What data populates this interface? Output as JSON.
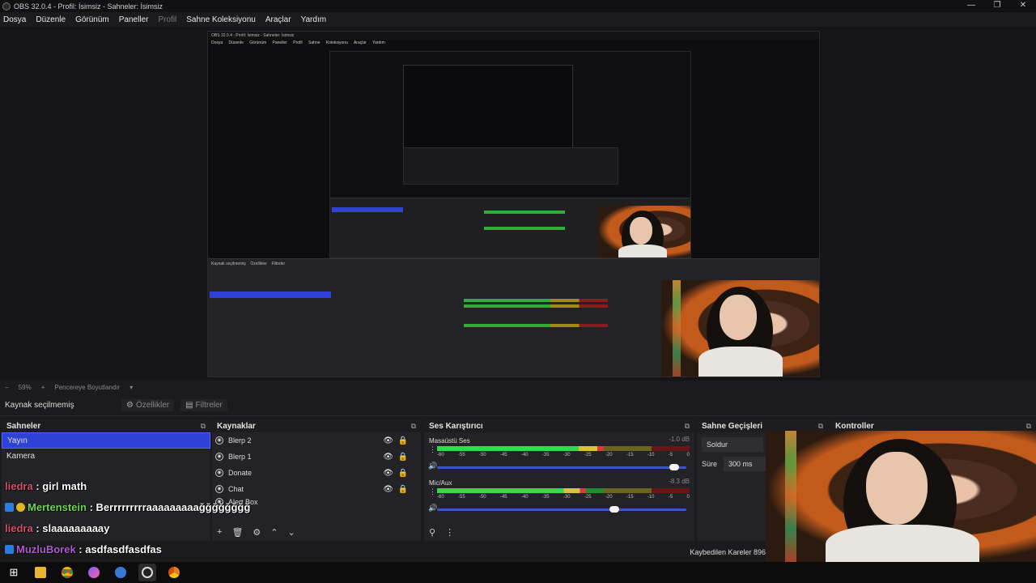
{
  "window": {
    "title": "OBS 32.0.4 - Profil: İsimsiz - Sahneler: İsimsiz"
  },
  "window_controls": {
    "min": "—",
    "max": "❐",
    "close": "✕"
  },
  "menu": [
    "Dosya",
    "Düzenle",
    "Görünüm",
    "Paneller",
    "Profil",
    "Sahne Koleksiyonu",
    "Araçlar",
    "Yardım"
  ],
  "menu_disabled": "Profil",
  "zoom": {
    "value": "59%",
    "plus": "+",
    "minus": "−",
    "mode": "Pencereye Boyutlandır"
  },
  "source_toolbar": {
    "no_selection": "Kaynak seçilmemiş",
    "properties": "Özellikler",
    "filters": "Filtreler"
  },
  "scenes": {
    "title": "Sahneler",
    "items": [
      "Yayın",
      "Kamera"
    ],
    "selected_index": 0
  },
  "sources": {
    "title": "Kaynaklar",
    "items": [
      "Blerp 2",
      "Blerp 1",
      "Donate",
      "Chat",
      "Alert Box"
    ]
  },
  "mixer": {
    "title": "Ses Karıştırıcı",
    "ticks": [
      "-60",
      "-55",
      "-50",
      "-45",
      "-40",
      "-35",
      "-30",
      "-25",
      "-20",
      "-15",
      "-10",
      "-5",
      "0"
    ],
    "channels": [
      {
        "name": "Masaüstü Ses",
        "db": "-1.0 dB",
        "level": 0.66,
        "volume": 0.95
      },
      {
        "name": "Mic/Aux",
        "db": "-8.3 dB",
        "level": 0.59,
        "volume": 0.71
      }
    ]
  },
  "transitions": {
    "title": "Sahne Geçişleri",
    "type": "Soldur",
    "duration_label": "Süre",
    "duration": "300 ms"
  },
  "controls": {
    "title": "Kontroller"
  },
  "chat": [
    {
      "user": "liedra",
      "text": " : girl math"
    },
    {
      "user": "Mertenstein",
      "text": " : Berrrrrrrrraaaaaaaaağğğğğğğğ"
    },
    {
      "user": "liedra",
      "text": " : slaaaaaaaaay"
    },
    {
      "user": "MuzluBorek",
      "text": " : asdfasdfasdfas"
    }
  ],
  "status": {
    "dropped_frames": "Kaybedilen Kareler 896"
  },
  "colors": {
    "accent": "#2f41d6",
    "meter_green": "#36d94a",
    "meter_yellow": "#d8c235",
    "meter_red": "#d93a3a"
  },
  "taskbar_icons": [
    "windows-start-icon",
    "file-explorer-icon",
    "chrome-icon",
    "messenger-icon",
    "settings-icon",
    "obs-icon",
    "chrome-canary-icon"
  ]
}
